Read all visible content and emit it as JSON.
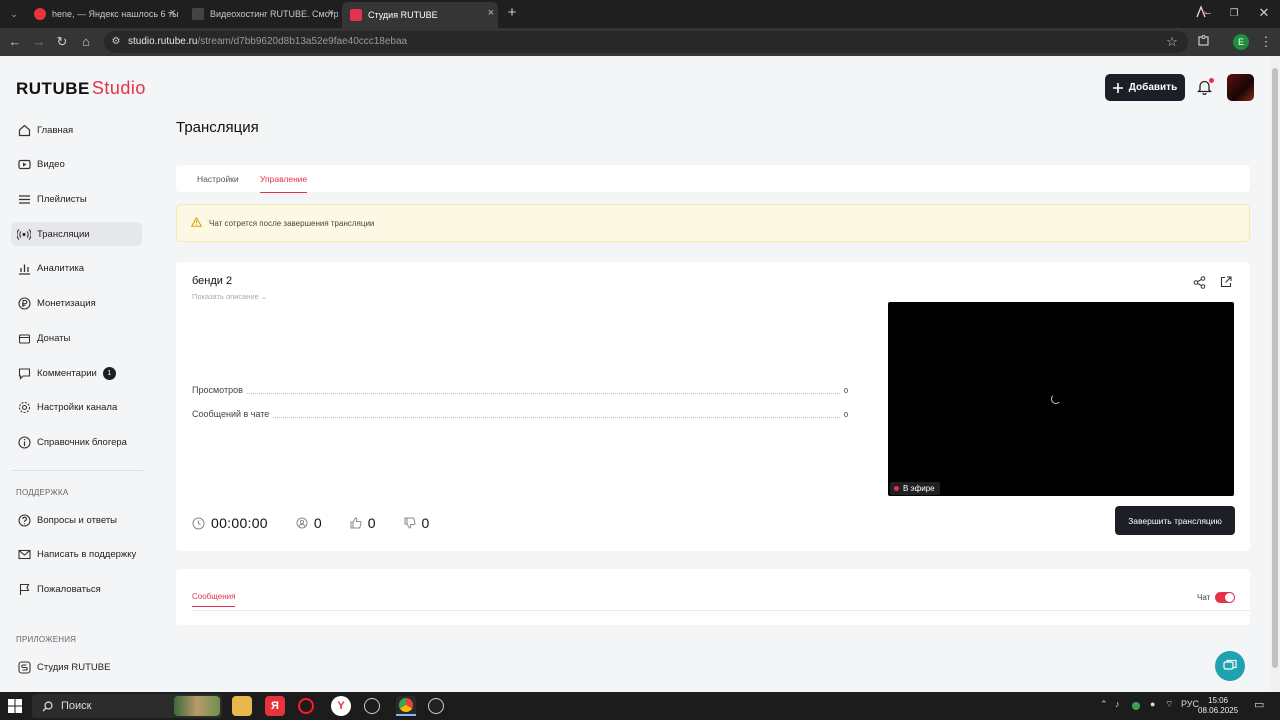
{
  "browser": {
    "tabs": [
      {
        "title": "hene, — Яндекс нашлось 6 ты",
        "favicon_color": "#e8323c"
      },
      {
        "title": "Видеохостинг RUTUBE. Смотрі",
        "favicon_color": "#2b2b2b"
      },
      {
        "title": "Студия RUTUBE",
        "favicon_color": "#e5314b"
      }
    ],
    "url_host": "studio.rutube.ru",
    "url_path": "/stream/d7bb9620d8b13a52e9fae40ccc18ebaa",
    "profile_letter": "E"
  },
  "header": {
    "logo_main": "RUTUBE",
    "logo_sub": "Studio",
    "add_label": "Добавить"
  },
  "sidebar": {
    "items": [
      {
        "label": "Главная",
        "icon": "home-icon"
      },
      {
        "label": "Видео",
        "icon": "video-icon"
      },
      {
        "label": "Плейлисты",
        "icon": "playlist-icon"
      },
      {
        "label": "Трансляции",
        "icon": "broadcast-icon"
      },
      {
        "label": "Аналитика",
        "icon": "analytics-icon"
      },
      {
        "label": "Монетизация",
        "icon": "ruble-icon"
      },
      {
        "label": "Донаты",
        "icon": "donate-icon"
      },
      {
        "label": "Комментарии",
        "icon": "comment-icon",
        "badge": "1"
      },
      {
        "label": "Настройки канала",
        "icon": "gear-icon"
      },
      {
        "label": "Справочник блогера",
        "icon": "info-icon"
      }
    ],
    "support_title": "ПОДДЕРЖКА",
    "support_items": [
      {
        "label": "Вопросы и ответы",
        "icon": "question-icon"
      },
      {
        "label": "Написать в поддержку",
        "icon": "mail-icon"
      },
      {
        "label": "Пожаловаться",
        "icon": "flag-icon"
      }
    ],
    "apps_title": "ПРИЛОЖЕНИЯ",
    "apps_items": [
      {
        "label": "Студия RUTUBE",
        "icon": "studio-app-icon"
      }
    ]
  },
  "main": {
    "title": "Трансляция",
    "tabs": [
      {
        "label": "Настройки"
      },
      {
        "label": "Управление"
      }
    ],
    "active_tab": "Управление",
    "warning": "Чат сотрется после завершения трансляции",
    "stream": {
      "name": "бенди 2",
      "show_description": "Показать описание",
      "stats": [
        {
          "label": "Просмотров",
          "value": "0"
        },
        {
          "label": "Сообщений в чате",
          "value": "0"
        }
      ],
      "live_label": "В эфире",
      "timer": "00:00:00",
      "viewers": "0",
      "likes": "0",
      "dislikes": "0",
      "end_label": "Завершить трансляцию"
    },
    "chat": {
      "tab_label": "Сообщения",
      "toggle_label": "Чат",
      "enabled": true
    }
  },
  "taskbar": {
    "search_label": "Поиск",
    "language": "РУС",
    "time": "15:06",
    "date": "08.06.2025"
  },
  "colors": {
    "accent": "#e5314b",
    "dark_button": "#1c1f26",
    "help_fab": "#1fa3b0"
  }
}
